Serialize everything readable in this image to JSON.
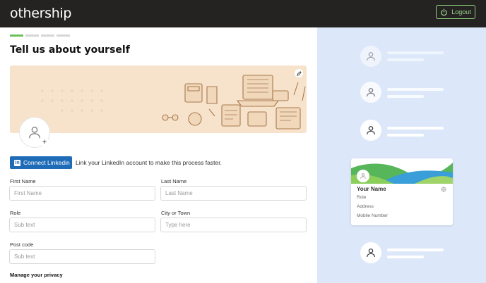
{
  "header": {
    "brand": "othership",
    "logout_label": "Logout",
    "accent": "#8fd07e",
    "background": "#252222"
  },
  "progress": {
    "steps": 4,
    "current": 1
  },
  "page": {
    "title": "Tell us about yourself"
  },
  "banner": {
    "edit_icon": "pencil-icon",
    "avatar_icon": "user-icon",
    "add_icon": "plus-icon",
    "background": "#f7e3cc"
  },
  "linkedin": {
    "button_label": "Connect Linkedin",
    "helper_text": "Link your LinkedIn account to make this process faster.",
    "color": "#1e6bb8"
  },
  "form": {
    "first_name": {
      "label": "First Name",
      "placeholder": "First Name"
    },
    "last_name": {
      "label": "Last Name",
      "placeholder": "Last Name"
    },
    "role": {
      "label": "Role",
      "placeholder": "Sub text"
    },
    "city": {
      "label": "City or Town",
      "placeholder": "Type here"
    },
    "postcode": {
      "label": "Post code",
      "placeholder": "Sub text"
    },
    "privacy_heading": "Manage your privacy"
  },
  "preview": {
    "background": "#dce8f9",
    "card": {
      "name": "Your Name",
      "role": "Role",
      "address": "Address",
      "mobile": "Mobile Number"
    }
  }
}
